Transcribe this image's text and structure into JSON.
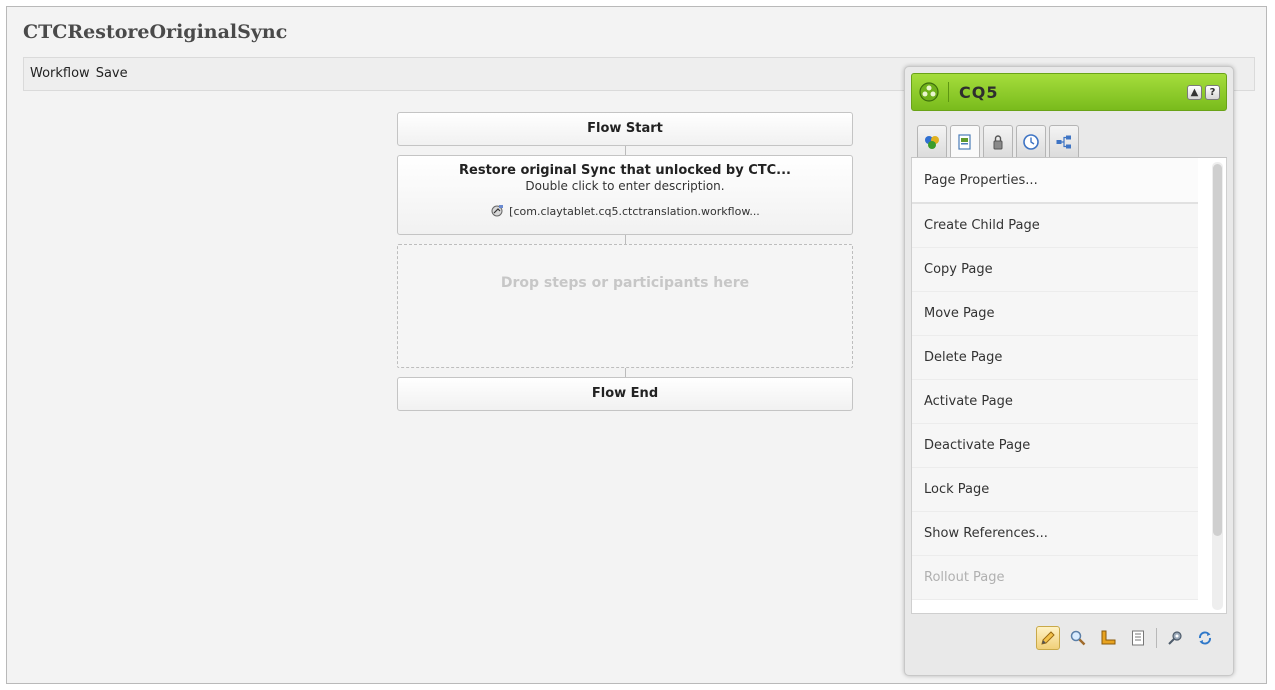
{
  "page": {
    "title": "CTCRestoreOriginalSync"
  },
  "toolbar": {
    "workflow_label": "Workflow",
    "save_label": "Save"
  },
  "flow": {
    "start_label": "Flow Start",
    "step": {
      "title": "Restore original Sync that unlocked by CTC...",
      "description": "Double click to enter description.",
      "implementation": "[com.claytablet.cq5.ctctranslation.workflow..."
    },
    "drop_zone_label": "Drop steps or participants here",
    "end_label": "Flow End"
  },
  "sidekick": {
    "title": "CQ5",
    "accent_color": "#8cc92a",
    "header_buttons": [
      "collapse-icon",
      "help-icon"
    ],
    "header_collapse_glyph": "▲",
    "header_help_glyph": "?",
    "tabs": [
      "components-icon",
      "page-icon",
      "lock-icon",
      "clock-icon",
      "workflow-icon"
    ],
    "active_tab": 1,
    "items": [
      {
        "label": "Page Properties...",
        "enabled": true
      },
      {
        "label": "Create Child Page",
        "enabled": true
      },
      {
        "label": "Copy Page",
        "enabled": true
      },
      {
        "label": "Move Page",
        "enabled": true
      },
      {
        "label": "Delete Page",
        "enabled": true
      },
      {
        "label": "Activate Page",
        "enabled": true
      },
      {
        "label": "Deactivate Page",
        "enabled": true
      },
      {
        "label": "Lock Page",
        "enabled": true
      },
      {
        "label": "Show References...",
        "enabled": true
      },
      {
        "label": "Rollout Page",
        "enabled": false
      }
    ],
    "footer_buttons": [
      "edit-mode-icon",
      "preview-mode-icon",
      "design-mode-icon",
      "scaffolding-icon",
      "settings-icon",
      "refresh-icon"
    ],
    "active_footer_button": 0
  }
}
